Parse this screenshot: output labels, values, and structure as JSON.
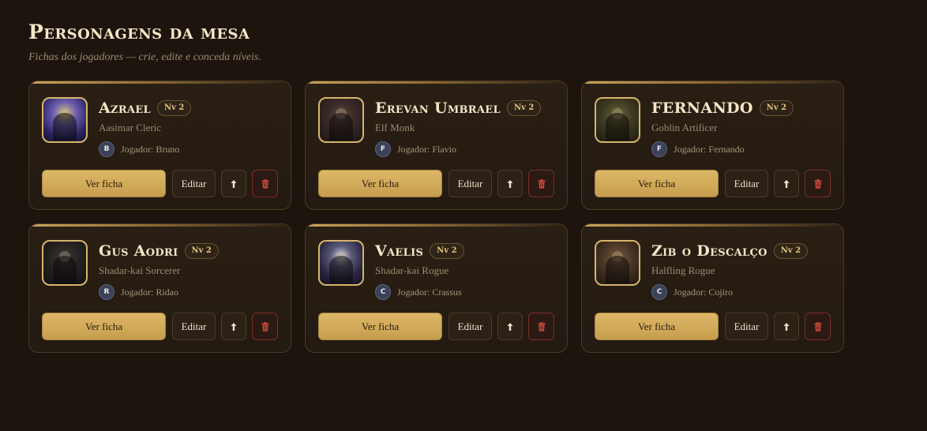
{
  "header": {
    "title": "Personagens da mesa",
    "subtitle": "Fichas dos jogadores — crie, edite e conceda níveis."
  },
  "actions": {
    "view_label": "Ver ficha",
    "edit_label": "Editar",
    "level_up_icon": "arrow-up-icon",
    "delete_icon": "trash-icon"
  },
  "colors": {
    "background": "#1c140d",
    "accent_gold": "#d7b56b",
    "danger": "#c0392b"
  },
  "characters": [
    {
      "name": "Azrael",
      "level": "Nv 2",
      "class": "Aasimar Cleric",
      "player_initial": "B",
      "player": "Jogador: Bruno"
    },
    {
      "name": "Erevan Umbrael",
      "level": "Nv 2",
      "class": "Elf Monk",
      "player_initial": "F",
      "player": "Jogador: Flavio"
    },
    {
      "name": "FERNANDO",
      "level": "Nv 2",
      "class": "Goblin Artificer",
      "player_initial": "F",
      "player": "Jogador: Fernando"
    },
    {
      "name": "Gus Aodri",
      "level": "Nv 2",
      "class": "Shadar-kai Sorcerer",
      "player_initial": "R",
      "player": "Jogador: Ridao"
    },
    {
      "name": "Vaelis",
      "level": "Nv 2",
      "class": "Shadar-kai Rogue",
      "player_initial": "C",
      "player": "Jogador: Crassus"
    },
    {
      "name": "Zib o Descalço",
      "level": "Nv 2",
      "class": "Halfling Rogue",
      "player_initial": "C",
      "player": "Jogador: Cojiro"
    }
  ]
}
